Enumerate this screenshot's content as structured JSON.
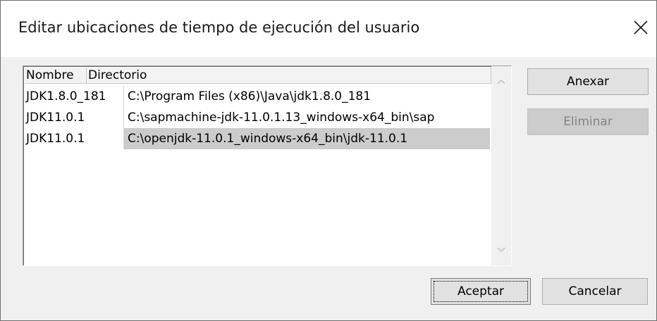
{
  "dialog": {
    "title": "Editar ubicaciones de tiempo de ejecución del usuario",
    "close_icon": "close-icon"
  },
  "list": {
    "columns": [
      "Nombre",
      "Directorio"
    ],
    "rows": [
      {
        "name": "JDK1.8.0_181",
        "directory": "C:\\Program Files (x86)\\Java\\jdk1.8.0_181",
        "selected": false
      },
      {
        "name": "JDK11.0.1",
        "directory": "C:\\sapmachine-jdk-11.0.1.13_windows-x64_bin\\sap",
        "selected": false
      },
      {
        "name": "JDK11.0.1",
        "directory": "C:\\openjdk-11.0.1_windows-x64_bin\\jdk-11.0.1",
        "selected": true
      }
    ],
    "scroll_icons": [
      "chevron-up-icon",
      "chevron-down-icon"
    ]
  },
  "buttons": {
    "anexar": "Anexar",
    "eliminar": "Eliminar",
    "aceptar": "Aceptar",
    "cancelar": "Cancelar"
  },
  "colors": {
    "dialog_bg": "#f0f0f0",
    "title_bg": "#ffffff",
    "selection_bg": "#cccccc",
    "disabled_text": "#838383"
  }
}
